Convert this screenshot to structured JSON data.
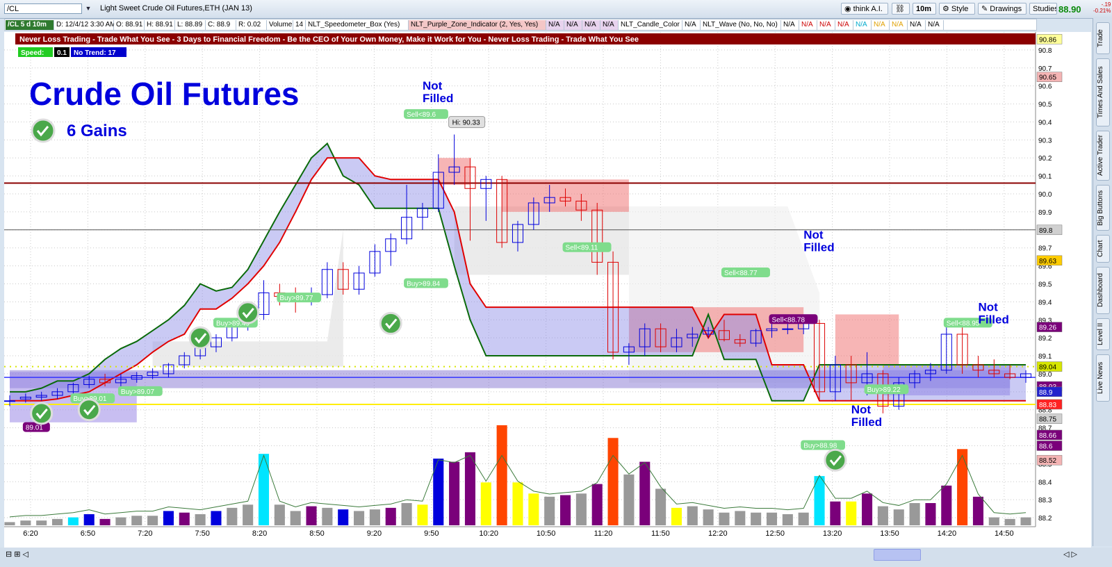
{
  "app": {
    "symbol": "/CL",
    "description": "Light Sweet Crude Oil Futures,ETH (JAN 13)",
    "think_label": "think A.I.",
    "interval_label": "10m",
    "style_label": "Style",
    "drawings_label": "Drawings",
    "studies_label": "Studies",
    "last_price": "88.90",
    "change_abs": "-.19",
    "change_pct": "-0.21%",
    "side_tabs": [
      "Trade",
      "Times And Sales",
      "Active Trader",
      "Big Buttons",
      "Chart",
      "Dashboard",
      "Level II",
      "Live News"
    ]
  },
  "status_bar": [
    {
      "text": "/CL 5 d 10m",
      "bg": "#2f7a2f",
      "fg": "#ffffff"
    },
    {
      "text": "D: 12/4/12 3:30 AM",
      "bg": "#ffffff",
      "fg": "#000000"
    },
    {
      "text": "O: 88.91",
      "bg": "#ffffff",
      "fg": "#000000"
    },
    {
      "text": "H: 88.91",
      "bg": "#ffffff",
      "fg": "#000000"
    },
    {
      "text": "L: 88.89",
      "bg": "#ffffff",
      "fg": "#000000"
    },
    {
      "text": "C: 88.9",
      "bg": "#ffffff",
      "fg": "#000000"
    },
    {
      "text": "R: 0.02",
      "bg": "#ffffff",
      "fg": "#000000"
    },
    {
      "text": "Volume",
      "bg": "#ffffff",
      "fg": "#000000"
    },
    {
      "text": "14",
      "bg": "#ffffff",
      "fg": "#000000"
    },
    {
      "text": "NLT_Speedometer_Box (Yes)",
      "bg": "#ffffff",
      "fg": "#000000"
    },
    {
      "text": "NLT_Purple_Zone_Indicator (2, Yes, Yes)",
      "bg": "#f4c7c7",
      "fg": "#000000"
    },
    {
      "text": "N/A",
      "bg": "#e8d3ee",
      "fg": "#000000"
    },
    {
      "text": "N/A",
      "bg": "#e8d3ee",
      "fg": "#000000"
    },
    {
      "text": "N/A",
      "bg": "#e8d3ee",
      "fg": "#000000"
    },
    {
      "text": "N/A",
      "bg": "#e8d3ee",
      "fg": "#000000"
    },
    {
      "text": "NLT_Candle_Color",
      "bg": "#ffffff",
      "fg": "#000000"
    },
    {
      "text": "N/A",
      "bg": "#ffffff",
      "fg": "#000000"
    },
    {
      "text": "NLT_Wave (No, No, No)",
      "bg": "#ffffff",
      "fg": "#000000"
    },
    {
      "text": "N/A",
      "bg": "#ffffff",
      "fg": "#000000"
    },
    {
      "text": "N/A",
      "bg": "#ffffff",
      "fg": "#cc0000"
    },
    {
      "text": "N/A",
      "bg": "#ffffff",
      "fg": "#cc0000"
    },
    {
      "text": "N/A",
      "bg": "#ffffff",
      "fg": "#cc0000"
    },
    {
      "text": "N/A",
      "bg": "#ffffff",
      "fg": "#00aacc"
    },
    {
      "text": "N/A",
      "bg": "#ffffff",
      "fg": "#e0a000"
    },
    {
      "text": "N/A",
      "bg": "#ffffff",
      "fg": "#e0a000"
    },
    {
      "text": "N/A",
      "bg": "#ffffff",
      "fg": "#000000"
    },
    {
      "text": "N/A",
      "bg": "#ffffff",
      "fg": "#000000"
    }
  ],
  "chart_data": {
    "type": "candlestick",
    "banner": "Never Loss Trading - Trade What You See - 3 Days to Financial Freedom - Be the CEO of Your Own Money, Make it Work for You - Never Loss Trading - Trade What You See",
    "speed_label": "Speed:",
    "speed_value": "0.1",
    "trend_label": "No Trend: 17",
    "title": "Crude Oil Futures",
    "gains_label": "6 Gains",
    "hi_label": "Hi: 90.33",
    "ylim": [
      88.15,
      90.9
    ],
    "yticks": [
      88.2,
      88.3,
      88.4,
      88.5,
      88.6,
      88.7,
      88.8,
      88.9,
      89.0,
      89.1,
      89.2,
      89.3,
      89.4,
      89.5,
      89.6,
      89.7,
      89.8,
      89.9,
      90.0,
      90.1,
      90.2,
      90.3,
      90.4,
      90.5,
      90.6,
      90.7,
      90.8
    ],
    "x_ticks": [
      "6:20",
      "6:50",
      "7:20",
      "7:50",
      "8:20",
      "8:50",
      "9:20",
      "9:50",
      "10:20",
      "10:50",
      "11:20",
      "11:50",
      "12:20",
      "12:50",
      "13:20",
      "13:50",
      "14:20",
      "14:50"
    ],
    "candles": [
      {
        "o": 88.85,
        "h": 88.88,
        "l": 88.82,
        "c": 88.85,
        "color": "#999999",
        "vol": 2
      },
      {
        "o": 88.86,
        "h": 88.89,
        "l": 88.84,
        "c": 88.87,
        "color": "#999999",
        "vol": 3
      },
      {
        "o": 88.87,
        "h": 88.9,
        "l": 88.85,
        "c": 88.88,
        "color": "#999999",
        "vol": 3
      },
      {
        "o": 88.88,
        "h": 88.92,
        "l": 88.86,
        "c": 88.9,
        "color": "#999999",
        "vol": 4
      },
      {
        "o": 88.9,
        "h": 88.95,
        "l": 88.88,
        "c": 88.94,
        "color": "#00e5ff",
        "vol": 5
      },
      {
        "o": 88.94,
        "h": 88.99,
        "l": 88.92,
        "c": 88.97,
        "color": "#0000dd",
        "vol": 7
      },
      {
        "o": 88.97,
        "h": 89.0,
        "l": 88.93,
        "c": 88.95,
        "color": "#7a007a",
        "vol": 4
      },
      {
        "o": 88.95,
        "h": 89.0,
        "l": 88.93,
        "c": 88.97,
        "color": "#999999",
        "vol": 5
      },
      {
        "o": 88.97,
        "h": 89.01,
        "l": 88.95,
        "c": 88.99,
        "color": "#999999",
        "vol": 6
      },
      {
        "o": 88.99,
        "h": 89.03,
        "l": 88.97,
        "c": 89.01,
        "color": "#999999",
        "vol": 6
      },
      {
        "o": 89.0,
        "h": 89.06,
        "l": 88.98,
        "c": 89.05,
        "color": "#0000dd",
        "vol": 9
      },
      {
        "o": 89.05,
        "h": 89.12,
        "l": 89.03,
        "c": 89.1,
        "color": "#7a007a",
        "vol": 8
      },
      {
        "o": 89.1,
        "h": 89.17,
        "l": 89.08,
        "c": 89.15,
        "color": "#999999",
        "vol": 7
      },
      {
        "o": 89.15,
        "h": 89.22,
        "l": 89.12,
        "c": 89.2,
        "color": "#0000dd",
        "vol": 9
      },
      {
        "o": 89.2,
        "h": 89.28,
        "l": 89.18,
        "c": 89.26,
        "color": "#999999",
        "vol": 11
      },
      {
        "o": 89.26,
        "h": 89.35,
        "l": 89.24,
        "c": 89.33,
        "color": "#999999",
        "vol": 13
      },
      {
        "o": 89.33,
        "h": 89.52,
        "l": 89.3,
        "c": 89.45,
        "color": "#00e5ff",
        "vol": 45
      },
      {
        "o": 89.45,
        "h": 89.5,
        "l": 89.38,
        "c": 89.43,
        "color": "#999999",
        "vol": 13
      },
      {
        "o": 89.43,
        "h": 89.48,
        "l": 89.34,
        "c": 89.4,
        "color": "#999999",
        "vol": 9
      },
      {
        "o": 89.4,
        "h": 89.48,
        "l": 89.38,
        "c": 89.44,
        "color": "#7a007a",
        "vol": 12
      },
      {
        "o": 89.44,
        "h": 89.62,
        "l": 89.42,
        "c": 89.58,
        "color": "#999999",
        "vol": 11
      },
      {
        "o": 89.58,
        "h": 89.62,
        "l": 89.44,
        "c": 89.47,
        "color": "#0000dd",
        "vol": 10
      },
      {
        "o": 89.47,
        "h": 89.6,
        "l": 89.44,
        "c": 89.56,
        "color": "#999999",
        "vol": 9
      },
      {
        "o": 89.56,
        "h": 89.72,
        "l": 89.54,
        "c": 89.68,
        "color": "#999999",
        "vol": 10
      },
      {
        "o": 89.68,
        "h": 89.78,
        "l": 89.6,
        "c": 89.75,
        "color": "#7a007a",
        "vol": 11
      },
      {
        "o": 89.75,
        "h": 90.05,
        "l": 89.72,
        "c": 89.87,
        "color": "#999999",
        "vol": 14
      },
      {
        "o": 89.87,
        "h": 89.95,
        "l": 89.8,
        "c": 89.92,
        "color": "#ffff00",
        "vol": 13
      },
      {
        "o": 89.92,
        "h": 90.22,
        "l": 89.9,
        "c": 90.12,
        "color": "#0000dd",
        "vol": 42
      },
      {
        "o": 90.12,
        "h": 90.33,
        "l": 90.05,
        "c": 90.15,
        "color": "#7a007a",
        "vol": 40
      },
      {
        "o": 90.15,
        "h": 90.2,
        "l": 89.74,
        "c": 90.03,
        "color": "#7a007a",
        "vol": 46
      },
      {
        "o": 90.03,
        "h": 90.1,
        "l": 89.85,
        "c": 90.08,
        "color": "#ffff00",
        "vol": 27
      },
      {
        "o": 90.08,
        "h": 90.1,
        "l": 89.7,
        "c": 89.73,
        "color": "#ff4500",
        "vol": 63
      },
      {
        "o": 89.73,
        "h": 89.85,
        "l": 89.68,
        "c": 89.83,
        "color": "#ffff00",
        "vol": 27
      },
      {
        "o": 89.83,
        "h": 89.98,
        "l": 89.8,
        "c": 89.95,
        "color": "#ffff00",
        "vol": 20
      },
      {
        "o": 89.95,
        "h": 90.05,
        "l": 89.9,
        "c": 89.98,
        "color": "#999999",
        "vol": 18
      },
      {
        "o": 89.98,
        "h": 90.03,
        "l": 89.93,
        "c": 89.96,
        "color": "#7a007a",
        "vol": 19
      },
      {
        "o": 89.96,
        "h": 90.0,
        "l": 89.85,
        "c": 89.91,
        "color": "#999999",
        "vol": 20
      },
      {
        "o": 89.91,
        "h": 89.95,
        "l": 89.55,
        "c": 89.62,
        "color": "#7a007a",
        "vol": 26
      },
      {
        "o": 89.62,
        "h": 89.68,
        "l": 89.08,
        "c": 89.12,
        "color": "#ff4500",
        "vol": 55
      },
      {
        "o": 89.12,
        "h": 89.17,
        "l": 89.05,
        "c": 89.15,
        "color": "#999999",
        "vol": 32
      },
      {
        "o": 89.15,
        "h": 89.28,
        "l": 89.1,
        "c": 89.25,
        "color": "#7a007a",
        "vol": 40
      },
      {
        "o": 89.25,
        "h": 89.28,
        "l": 89.12,
        "c": 89.15,
        "color": "#999999",
        "vol": 23
      },
      {
        "o": 89.15,
        "h": 89.25,
        "l": 89.12,
        "c": 89.2,
        "color": "#ffff00",
        "vol": 11
      },
      {
        "o": 89.2,
        "h": 89.26,
        "l": 89.15,
        "c": 89.22,
        "color": "#999999",
        "vol": 12
      },
      {
        "o": 89.22,
        "h": 89.26,
        "l": 89.2,
        "c": 89.24,
        "color": "#999999",
        "vol": 10
      },
      {
        "o": 89.24,
        "h": 89.3,
        "l": 89.18,
        "c": 89.19,
        "color": "#999999",
        "vol": 8
      },
      {
        "o": 89.19,
        "h": 89.22,
        "l": 89.15,
        "c": 89.17,
        "color": "#999999",
        "vol": 9
      },
      {
        "o": 89.17,
        "h": 89.25,
        "l": 89.15,
        "c": 89.24,
        "color": "#999999",
        "vol": 8
      },
      {
        "o": 89.24,
        "h": 89.28,
        "l": 89.2,
        "c": 89.25,
        "color": "#999999",
        "vol": 8
      },
      {
        "o": 89.25,
        "h": 89.3,
        "l": 89.22,
        "c": 89.25,
        "color": "#999999",
        "vol": 7
      },
      {
        "o": 89.25,
        "h": 89.32,
        "l": 89.22,
        "c": 89.28,
        "color": "#999999",
        "vol": 8
      },
      {
        "o": 89.28,
        "h": 89.3,
        "l": 88.85,
        "c": 88.9,
        "color": "#00e5ff",
        "vol": 31
      },
      {
        "o": 88.9,
        "h": 89.1,
        "l": 88.85,
        "c": 89.05,
        "color": "#7a007a",
        "vol": 15
      },
      {
        "o": 89.05,
        "h": 89.1,
        "l": 88.85,
        "c": 88.95,
        "color": "#ffff00",
        "vol": 15
      },
      {
        "o": 88.95,
        "h": 89.12,
        "l": 88.88,
        "c": 89.0,
        "color": "#7a007a",
        "vol": 20
      },
      {
        "o": 89.0,
        "h": 89.02,
        "l": 88.78,
        "c": 88.82,
        "color": "#999999",
        "vol": 12
      },
      {
        "o": 88.82,
        "h": 88.98,
        "l": 88.8,
        "c": 88.95,
        "color": "#999999",
        "vol": 10
      },
      {
        "o": 88.95,
        "h": 89.02,
        "l": 88.92,
        "c": 89.0,
        "color": "#999999",
        "vol": 14
      },
      {
        "o": 89.0,
        "h": 89.06,
        "l": 88.96,
        "c": 89.02,
        "color": "#7a007a",
        "vol": 14
      },
      {
        "o": 89.02,
        "h": 89.3,
        "l": 89.0,
        "c": 89.22,
        "color": "#7a007a",
        "vol": 25
      },
      {
        "o": 89.22,
        "h": 89.26,
        "l": 89.0,
        "c": 89.05,
        "color": "#ff4500",
        "vol": 48
      },
      {
        "o": 89.05,
        "h": 89.1,
        "l": 88.98,
        "c": 89.02,
        "color": "#7a007a",
        "vol": 18
      },
      {
        "o": 89.02,
        "h": 89.08,
        "l": 88.98,
        "c": 89.0,
        "color": "#999999",
        "vol": 5
      },
      {
        "o": 89.0,
        "h": 89.05,
        "l": 88.97,
        "c": 88.98,
        "color": "#999999",
        "vol": 4
      },
      {
        "o": 88.98,
        "h": 89.02,
        "l": 88.95,
        "c": 89.0,
        "color": "#999999",
        "vol": 5
      }
    ],
    "zones": [
      {
        "x0": 0,
        "x1": 8,
        "top": 89.01,
        "bottom": 88.73,
        "color": "#9a88e6"
      },
      {
        "x0": 27,
        "x1": 29,
        "top": 90.2,
        "bottom": 90.05,
        "color": "#f07878"
      },
      {
        "x0": 31,
        "x1": 39,
        "top": 90.08,
        "bottom": 89.9,
        "color": "#f07878"
      },
      {
        "x0": 39,
        "x1": 50,
        "top": 89.37,
        "bottom": 89.12,
        "color": "#f07878"
      },
      {
        "x0": 52,
        "x1": 56,
        "top": 89.33,
        "bottom": 89.05,
        "color": "#f07878"
      },
      {
        "x0": 55,
        "x1": 63,
        "top": 89.05,
        "bottom": 88.88,
        "color": "#9a88e6"
      }
    ],
    "hlines": [
      {
        "y": 90.06,
        "color": "#8b0000",
        "width": 2,
        "dash": ""
      },
      {
        "y": 89.8,
        "color": "#555555",
        "width": 1,
        "dash": ""
      },
      {
        "y": 89.04,
        "color": "#d6e600",
        "width": 2,
        "dash": "2,6"
      },
      {
        "y": 88.98,
        "color": "#3333ff",
        "width": 1.5,
        "dash": ""
      },
      {
        "y": 88.83,
        "color": "#ffee00",
        "width": 2,
        "dash": ""
      }
    ],
    "purple_band": {
      "x0": 0,
      "x1": 63,
      "top": 89.02,
      "bottom": 88.92,
      "color": "#7766cc"
    },
    "line_up": [
      88.9,
      88.9,
      88.92,
      88.96,
      88.96,
      89.0,
      89.08,
      89.14,
      89.18,
      89.24,
      89.3,
      89.38,
      89.5,
      89.46,
      89.48,
      89.58,
      89.74,
      89.9,
      90.05,
      90.2,
      90.28,
      90.1,
      90.05,
      89.92,
      89.92,
      89.92,
      89.92,
      89.92,
      89.6,
      89.3,
      89.1,
      89.1,
      89.1,
      89.1,
      89.1,
      89.1,
      89.1,
      89.1,
      89.1,
      89.1,
      89.1,
      89.1,
      89.1,
      89.1,
      89.33,
      89.08,
      89.08,
      89.08,
      88.85,
      88.85,
      88.85,
      89.05,
      89.05,
      89.05,
      89.05,
      89.05,
      89.05,
      89.05,
      89.05,
      89.05,
      89.05,
      89.05,
      89.05,
      89.05,
      89.05
    ],
    "line_dn": [
      88.85,
      88.85,
      88.85,
      88.86,
      88.88,
      88.9,
      88.95,
      89.0,
      89.05,
      89.12,
      89.18,
      89.22,
      89.36,
      89.36,
      89.42,
      89.5,
      89.6,
      89.73,
      89.9,
      90.08,
      90.2,
      90.2,
      90.2,
      90.1,
      90.08,
      90.08,
      90.08,
      90.08,
      89.9,
      89.5,
      89.37,
      89.37,
      89.37,
      89.37,
      89.37,
      89.37,
      89.37,
      89.37,
      89.37,
      89.37,
      89.37,
      89.37,
      89.37,
      89.37,
      89.2,
      89.33,
      89.33,
      89.33,
      89.05,
      89.05,
      89.05,
      88.85,
      88.85,
      88.85,
      88.85,
      88.85,
      88.85,
      88.85,
      88.85,
      88.85,
      88.85,
      88.85,
      88.85,
      88.85,
      88.85
    ],
    "signals": [
      {
        "i": 4,
        "price": 88.86,
        "text": "Buy>89.01",
        "kind": "buy"
      },
      {
        "i": 7,
        "price": 88.9,
        "text": "Buy>89.07",
        "kind": "buy"
      },
      {
        "i": 13,
        "price": 89.28,
        "text": "Buy>89.49",
        "kind": "buy"
      },
      {
        "i": 17,
        "price": 89.42,
        "text": "Buy>89.77",
        "kind": "buy"
      },
      {
        "i": 25,
        "price": 89.5,
        "text": "Buy>89.84",
        "kind": "buy"
      },
      {
        "i": 25,
        "price": 90.44,
        "text": "Sell<89.6",
        "kind": "sell"
      },
      {
        "i": 35,
        "price": 89.7,
        "text": "Sell<89.11",
        "kind": "sell"
      },
      {
        "i": 45,
        "price": 89.56,
        "text": "Sell<88.77",
        "kind": "sell"
      },
      {
        "i": 48,
        "price": 89.3,
        "text": "Sell<88.78",
        "kind": "sellp"
      },
      {
        "i": 50,
        "price": 88.6,
        "text": "Buy>88.98",
        "kind": "buy"
      },
      {
        "i": 54,
        "price": 88.91,
        "text": "Buy>89.22",
        "kind": "buy"
      },
      {
        "i": 59,
        "price": 89.28,
        "text": "Sell<88.95",
        "kind": "sell"
      },
      {
        "i": 1,
        "price": 88.7,
        "text": "89.01",
        "kind": "sellp"
      }
    ],
    "checks": [
      {
        "i": 2,
        "price": 88.78
      },
      {
        "i": 5,
        "price": 88.8
      },
      {
        "i": 12,
        "price": 89.2
      },
      {
        "i": 15,
        "price": 89.34
      },
      {
        "i": 24,
        "price": 89.28
      },
      {
        "i": 52,
        "price": 88.52
      }
    ],
    "not_filled": [
      {
        "i": 26,
        "price": 90.58
      },
      {
        "i": 50,
        "price": 89.75
      },
      {
        "i": 53,
        "price": 88.78
      },
      {
        "i": 61,
        "price": 89.35
      }
    ],
    "not_filled_text": [
      "Not",
      "Filled"
    ],
    "right_tags": [
      {
        "v": 90.86,
        "text": "90.86",
        "bg": "#ffff99",
        "fg": "#000000"
      },
      {
        "v": 90.65,
        "text": "90.65",
        "bg": "#f4b4b4",
        "fg": "#000000"
      },
      {
        "v": 89.8,
        "text": "89.8",
        "bg": "#d0d0d0",
        "fg": "#000000"
      },
      {
        "v": 89.63,
        "text": "89.63",
        "bg": "#ffcc00",
        "fg": "#000000"
      },
      {
        "v": 89.26,
        "text": "89.26",
        "bg": "#7a007a",
        "fg": "#ffffff"
      },
      {
        "v": 89.04,
        "text": "89.04",
        "bg": "#d6e600",
        "fg": "#000000"
      },
      {
        "v": 88.93,
        "text": "88.93",
        "bg": "#7a007a",
        "fg": "#ffffff"
      },
      {
        "v": 88.9,
        "text": "88.9",
        "bg": "#2222cc",
        "fg": "#ffffff"
      },
      {
        "v": 88.83,
        "text": "88.83",
        "bg": "#ff2222",
        "fg": "#ffffff"
      },
      {
        "v": 88.75,
        "text": "88.75",
        "bg": "#d0d0d0",
        "fg": "#000000"
      },
      {
        "v": 88.66,
        "text": "88.66",
        "bg": "#7a007a",
        "fg": "#ffffff"
      },
      {
        "v": 88.6,
        "text": "88.6",
        "bg": "#7a007a",
        "fg": "#ffffff"
      },
      {
        "v": 88.52,
        "text": "88.52",
        "bg": "#f4b4b4",
        "fg": "#000000"
      }
    ],
    "vol_ylim": [
      0,
      70
    ]
  }
}
